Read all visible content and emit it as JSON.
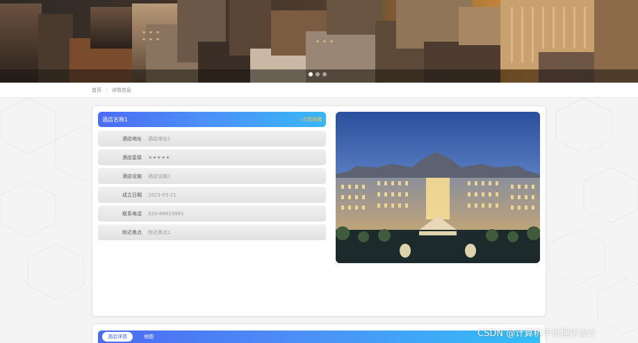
{
  "banner": {
    "slide_count": 3,
    "active_slide": 0
  },
  "breadcrumb": {
    "home": "首页",
    "separator": "::",
    "current": "详情信息"
  },
  "detail": {
    "hotel_name": "酒店名称1",
    "collect_label": "☆点我收藏",
    "fields": [
      {
        "label": "酒店地址",
        "value": "酒店地址1"
      },
      {
        "label": "酒店星级",
        "value": "★★★★★"
      },
      {
        "label": "酒店设施",
        "value": "酒店设施1"
      },
      {
        "label": "成立日期",
        "value": "2023-03-21"
      },
      {
        "label": "联系电话",
        "value": "020-89819991"
      },
      {
        "label": "附近景点",
        "value": "附近景点1"
      }
    ]
  },
  "tabs": [
    {
      "label": "酒店详情",
      "active": true
    },
    {
      "label": "地图",
      "active": false
    }
  ],
  "watermark": "CSDN @计算机毕设程序设计",
  "colors": {
    "accent_start": "#4b6bf3",
    "accent_end": "#39b7f6",
    "collect_color": "#f3c15a"
  }
}
